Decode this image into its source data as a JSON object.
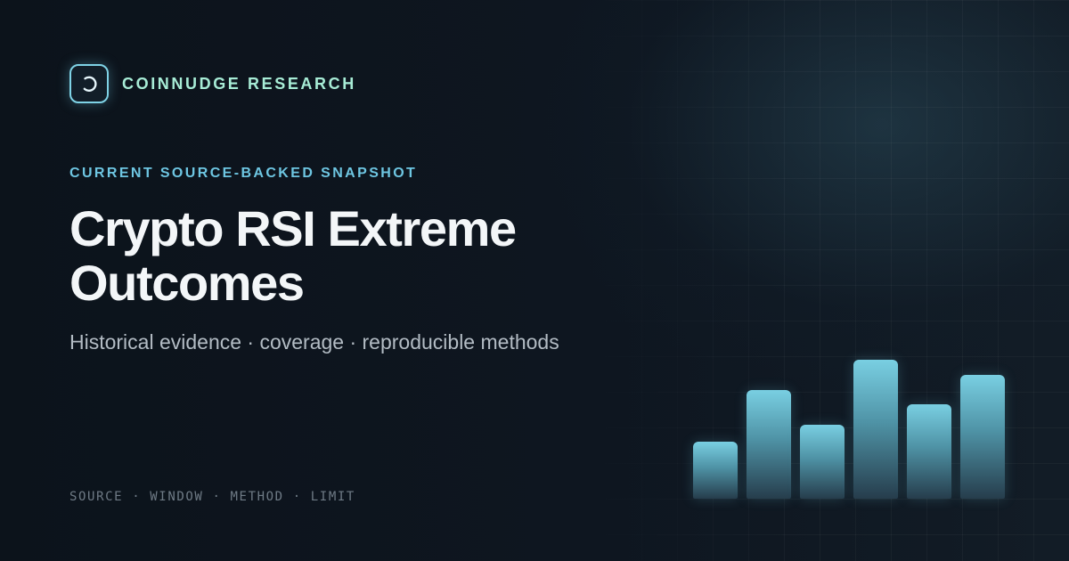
{
  "brand": {
    "name": "COINNUDGE RESEARCH",
    "logo_icon": "refresh-arc-icon",
    "accent": "#7fd3e6"
  },
  "hero": {
    "kicker": "CURRENT SOURCE-BACKED SNAPSHOT",
    "title_line1": "Crypto RSI Extreme",
    "title_line2": "Outcomes",
    "subtitle": "Historical evidence · coverage · reproducible methods"
  },
  "footer": {
    "text": "SOURCE · WINDOW · METHOD · LIMIT"
  },
  "decorative_bars": {
    "levels": [
      0.41,
      0.78,
      0.53,
      1.0,
      0.68,
      0.89
    ],
    "color_top": "#79cfe2",
    "color_bottom": "#263d4c"
  },
  "colors": {
    "background": "#0d141c",
    "brand_text": "#a7ecd6",
    "kicker": "#6ec6e2",
    "title": "#f3f6f8",
    "subtitle": "#b3bcc4",
    "footer": "#6f7b86"
  }
}
